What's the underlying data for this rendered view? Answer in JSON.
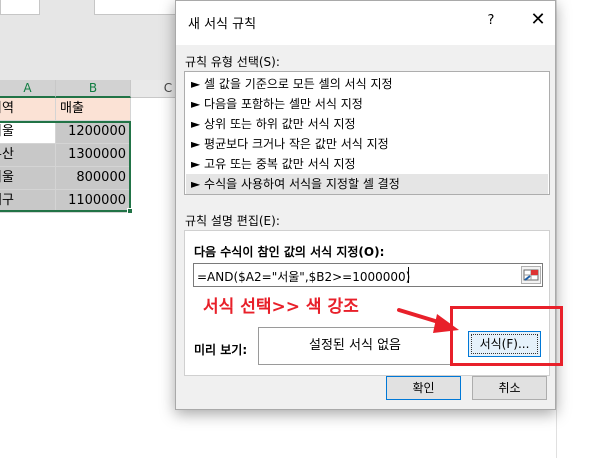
{
  "spreadsheet": {
    "columns": [
      "A",
      "B",
      "C"
    ],
    "header_row": [
      "지역",
      "매출"
    ],
    "rows": [
      {
        "region": "서울",
        "sales": "1200000"
      },
      {
        "region": "부산",
        "sales": "1300000"
      },
      {
        "region": "서울",
        "sales": "800000"
      },
      {
        "region": "대구",
        "sales": "1100000"
      }
    ]
  },
  "dialog": {
    "title": "새 서식 규칙",
    "help": "?",
    "close": "✕",
    "rule_type_label": "규칙 유형 선택(S):",
    "rule_types": [
      "► 셀 값을 기준으로 모든 셀의 서식 지정",
      "► 다음을 포함하는 셀만 서식 지정",
      "► 상위 또는 하위 값만 서식 지정",
      "► 평균보다 크거나 작은 값만 서식 지정",
      "► 고유 또는 중복 값만 서식 지정",
      "► 수식을 사용하여 서식을 지정할 셀 결정"
    ],
    "selected_rule_index": 5,
    "description_label": "규칙 설명 편집(E):",
    "formula_heading": "다음 수식이 참인 값의 서식 지정(O):",
    "formula_value": "=AND($A2=\"서울\",$B2>=1000000)",
    "preview_label": "미리 보기:",
    "preview_text": "설정된 서식 없음",
    "format_button": "서식(F)...",
    "ok_button": "확인",
    "cancel_button": "취소"
  },
  "annotation": {
    "text": "서식 선택>> 색 강조",
    "color": "#e8202a"
  },
  "colors": {
    "header_fill": "#fbe2d5",
    "grey_fill": "#c8c8c8",
    "selection_green": "#217346",
    "focus_blue": "#0078d7"
  }
}
